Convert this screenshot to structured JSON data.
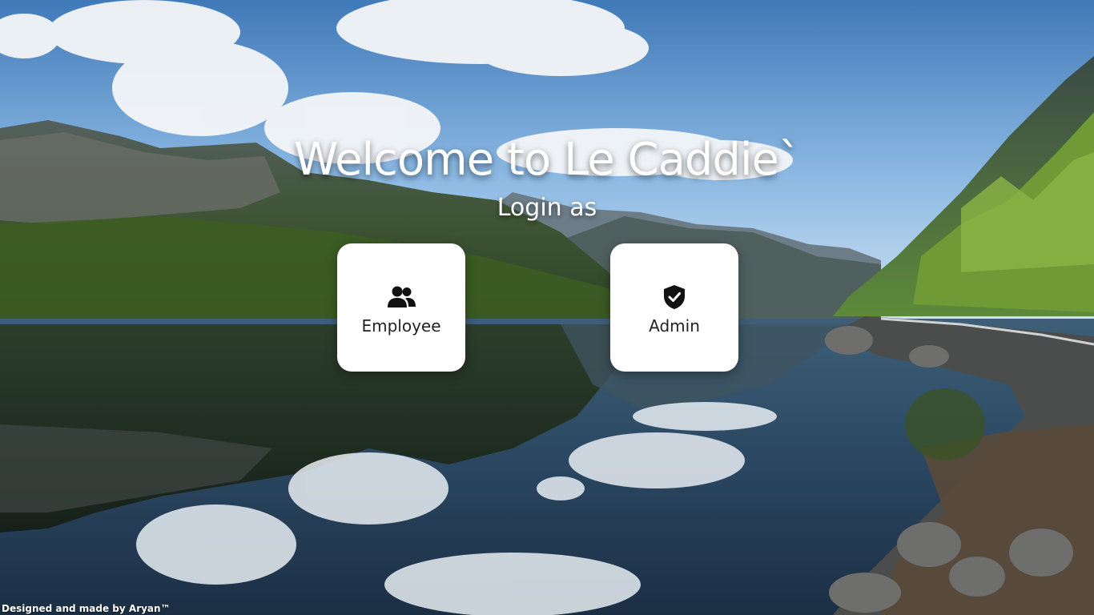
{
  "page": {
    "title": "Welcome to Le Caddie`",
    "subtitle": "Login as"
  },
  "options": [
    {
      "label": "Employee",
      "icon": "users-icon"
    },
    {
      "label": "Admin",
      "icon": "shield-check-icon"
    }
  ],
  "footer": {
    "text": "Designed and made by Aryan™"
  },
  "colors": {
    "card_background": "#ffffff",
    "card_text": "#222222",
    "headline_text": "#ffffff",
    "sky": "#5a8fc8"
  }
}
